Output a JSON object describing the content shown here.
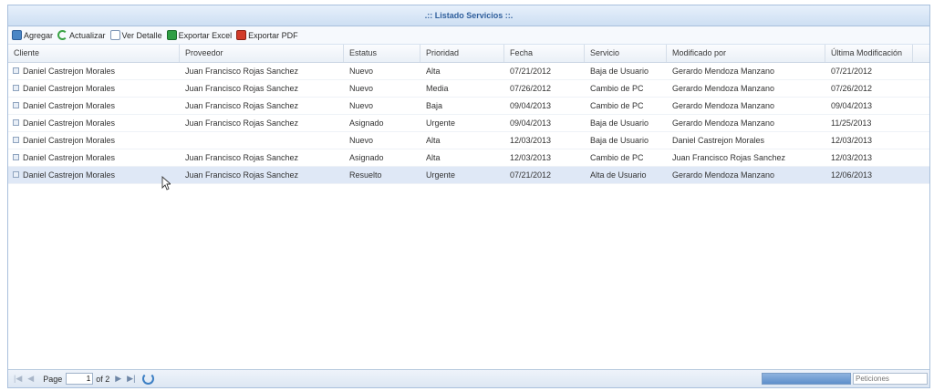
{
  "window": {
    "title": ".:: Listado Servicios ::."
  },
  "toolbar": {
    "add": "Agregar",
    "refresh": "Actualizar",
    "detail": "Ver Detalle",
    "excel": "Exportar Excel",
    "pdf": "Exportar PDF"
  },
  "table": {
    "columns": [
      "Cliente",
      "Proveedor",
      "Estatus",
      "Prioridad",
      "Fecha",
      "Servicio",
      "Modificado por",
      "Última Modificación"
    ],
    "rows": [
      [
        "Daniel Castrejon Morales",
        "Juan Francisco Rojas Sanchez",
        "Nuevo",
        "Alta",
        "07/21/2012",
        "Baja de Usuario",
        "Gerardo Mendoza Manzano",
        "07/21/2012"
      ],
      [
        "Daniel Castrejon Morales",
        "Juan Francisco Rojas Sanchez",
        "Nuevo",
        "Media",
        "07/26/2012",
        "Cambio de PC",
        "Gerardo Mendoza Manzano",
        "07/26/2012"
      ],
      [
        "Daniel Castrejon Morales",
        "Juan Francisco Rojas Sanchez",
        "Nuevo",
        "Baja",
        "09/04/2013",
        "Cambio de PC",
        "Gerardo Mendoza Manzano",
        "09/04/2013"
      ],
      [
        "Daniel Castrejon Morales",
        "Juan Francisco Rojas Sanchez",
        "Asignado",
        "Urgente",
        "09/04/2013",
        "Baja de Usuario",
        "Gerardo Mendoza Manzano",
        "11/25/2013"
      ],
      [
        "Daniel Castrejon Morales",
        "",
        "Nuevo",
        "Alta",
        "12/03/2013",
        "Baja de Usuario",
        "Daniel Castrejon Morales",
        "12/03/2013"
      ],
      [
        "Daniel Castrejon Morales",
        "Juan Francisco Rojas Sanchez",
        "Asignado",
        "Alta",
        "12/03/2013",
        "Cambio de PC",
        "Juan Francisco Rojas Sanchez",
        "12/03/2013"
      ],
      [
        "Daniel Castrejon Morales",
        "Juan Francisco Rojas Sanchez",
        "Resuelto",
        "Urgente",
        "07/21/2012",
        "Alta de Usuario",
        "Gerardo Mendoza Manzano",
        "12/06/2013"
      ]
    ],
    "selected_row": 6
  },
  "pager": {
    "page_label": "Page",
    "page_value": "1",
    "of_label": "of 2",
    "search_placeholder": "Peticiones"
  }
}
